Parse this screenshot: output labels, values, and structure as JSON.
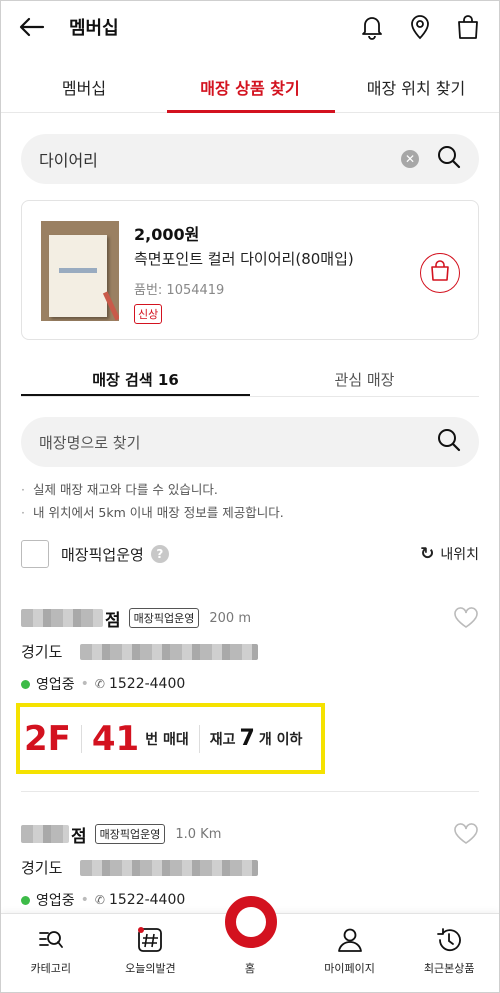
{
  "header": {
    "title": "멤버십"
  },
  "tabs": [
    {
      "label": "멤버십"
    },
    {
      "label": "매장 상품 찾기"
    },
    {
      "label": "매장 위치 찾기"
    }
  ],
  "search": {
    "query": "다이어리"
  },
  "product": {
    "price": "2,000원",
    "name": "측면포인트 컬러 다이어리(80매입)",
    "code": "품번: 1054419",
    "badge": "신상"
  },
  "subtabs": [
    {
      "label": "매장 검색 16"
    },
    {
      "label": "관심 매장"
    }
  ],
  "store_search": {
    "placeholder": "매장명으로 찾기"
  },
  "notes": [
    "실제 매장 재고와 다를 수 있습니다.",
    "내 위치에서 5km 이내 매장 정보를 제공합니다."
  ],
  "pickup": {
    "label": "매장픽업운영",
    "help": "?",
    "my_location": "내위치"
  },
  "stores": [
    {
      "name_suffix": "점",
      "tag": "매장픽업운영",
      "distance": "200 m",
      "address": "경기도",
      "status": "영업중",
      "phone": "1522-4400",
      "stock": {
        "floor": "2F",
        "shelf": "41",
        "shelf_unit": "번 매대",
        "stock_label": "재고",
        "stock_count": "7",
        "stock_suffix": "개 이하"
      }
    },
    {
      "name_suffix": "점",
      "tag": "매장픽업운영",
      "distance": "1.0 Km",
      "address": "경기도",
      "status": "영업중",
      "phone": "1522-4400"
    }
  ],
  "bottom_nav": [
    {
      "label": "카테고리"
    },
    {
      "label": "오늘의발견"
    },
    {
      "label": "홈"
    },
    {
      "label": "마이페이지"
    },
    {
      "label": "최근본상품"
    }
  ],
  "colors": {
    "accent": "#d3121f",
    "highlight": "#f5e200",
    "open": "#3dbb48"
  }
}
